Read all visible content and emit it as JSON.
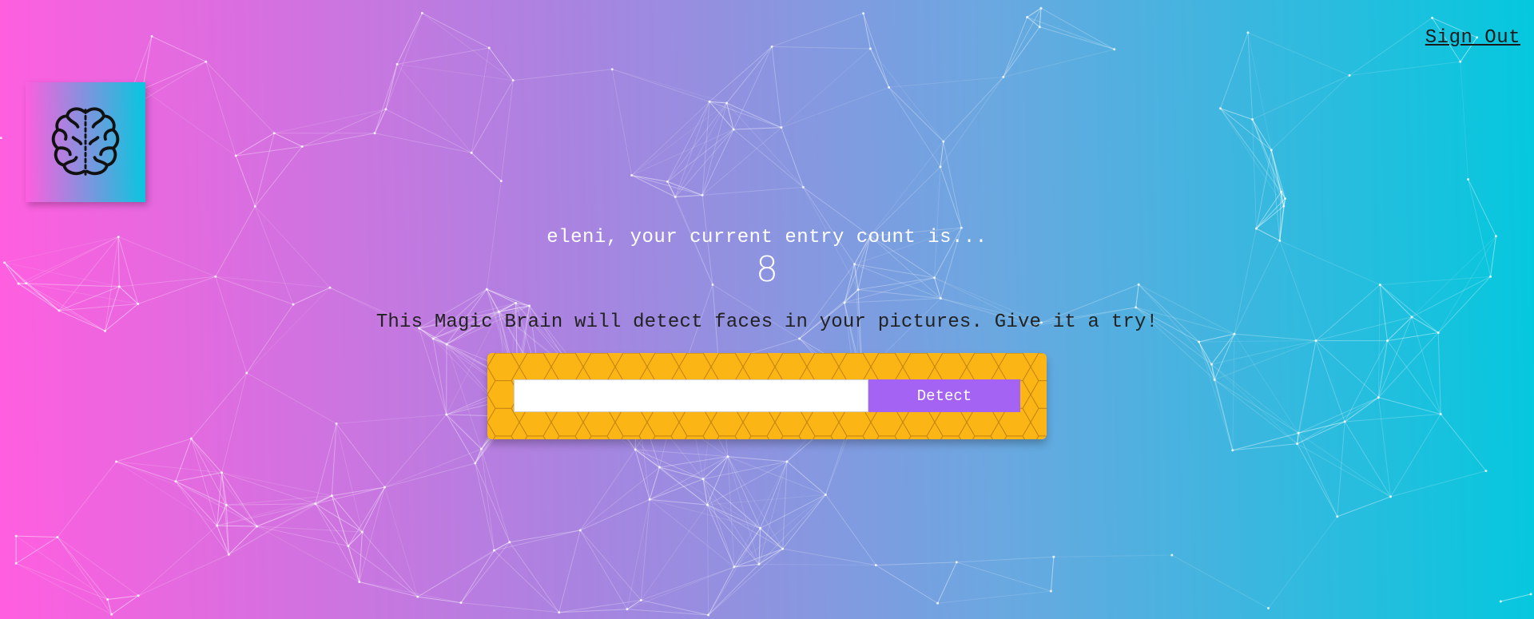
{
  "nav": {
    "sign_out_label": "Sign Out"
  },
  "logo": {
    "icon": "brain-icon"
  },
  "rank": {
    "message": "eleni, your current entry count is...",
    "count": "8"
  },
  "image_link_form": {
    "intro_text": "This Magic Brain will detect faces in your pictures. Give it a try!",
    "input_value": "",
    "input_placeholder": "",
    "detect_button_label": "Detect"
  },
  "colors": {
    "gradient_left": "#ff5edf",
    "gradient_right": "#04c8de",
    "form_background": "#fbb515",
    "detect_button": "#a463f2"
  }
}
